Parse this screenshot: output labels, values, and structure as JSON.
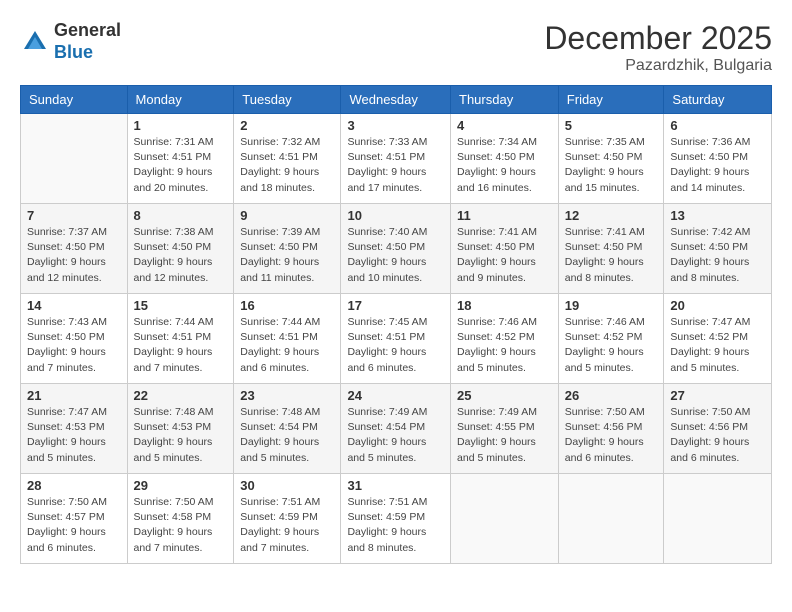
{
  "logo": {
    "general": "General",
    "blue": "Blue"
  },
  "title": {
    "month_year": "December 2025",
    "location": "Pazardzhik, Bulgaria"
  },
  "days_of_week": [
    "Sunday",
    "Monday",
    "Tuesday",
    "Wednesday",
    "Thursday",
    "Friday",
    "Saturday"
  ],
  "weeks": [
    [
      {
        "day": "",
        "info": ""
      },
      {
        "day": "1",
        "info": "Sunrise: 7:31 AM\nSunset: 4:51 PM\nDaylight: 9 hours\nand 20 minutes."
      },
      {
        "day": "2",
        "info": "Sunrise: 7:32 AM\nSunset: 4:51 PM\nDaylight: 9 hours\nand 18 minutes."
      },
      {
        "day": "3",
        "info": "Sunrise: 7:33 AM\nSunset: 4:51 PM\nDaylight: 9 hours\nand 17 minutes."
      },
      {
        "day": "4",
        "info": "Sunrise: 7:34 AM\nSunset: 4:50 PM\nDaylight: 9 hours\nand 16 minutes."
      },
      {
        "day": "5",
        "info": "Sunrise: 7:35 AM\nSunset: 4:50 PM\nDaylight: 9 hours\nand 15 minutes."
      },
      {
        "day": "6",
        "info": "Sunrise: 7:36 AM\nSunset: 4:50 PM\nDaylight: 9 hours\nand 14 minutes."
      }
    ],
    [
      {
        "day": "7",
        "info": "Sunrise: 7:37 AM\nSunset: 4:50 PM\nDaylight: 9 hours\nand 12 minutes."
      },
      {
        "day": "8",
        "info": "Sunrise: 7:38 AM\nSunset: 4:50 PM\nDaylight: 9 hours\nand 12 minutes."
      },
      {
        "day": "9",
        "info": "Sunrise: 7:39 AM\nSunset: 4:50 PM\nDaylight: 9 hours\nand 11 minutes."
      },
      {
        "day": "10",
        "info": "Sunrise: 7:40 AM\nSunset: 4:50 PM\nDaylight: 9 hours\nand 10 minutes."
      },
      {
        "day": "11",
        "info": "Sunrise: 7:41 AM\nSunset: 4:50 PM\nDaylight: 9 hours\nand 9 minutes."
      },
      {
        "day": "12",
        "info": "Sunrise: 7:41 AM\nSunset: 4:50 PM\nDaylight: 9 hours\nand 8 minutes."
      },
      {
        "day": "13",
        "info": "Sunrise: 7:42 AM\nSunset: 4:50 PM\nDaylight: 9 hours\nand 8 minutes."
      }
    ],
    [
      {
        "day": "14",
        "info": "Sunrise: 7:43 AM\nSunset: 4:50 PM\nDaylight: 9 hours\nand 7 minutes."
      },
      {
        "day": "15",
        "info": "Sunrise: 7:44 AM\nSunset: 4:51 PM\nDaylight: 9 hours\nand 7 minutes."
      },
      {
        "day": "16",
        "info": "Sunrise: 7:44 AM\nSunset: 4:51 PM\nDaylight: 9 hours\nand 6 minutes."
      },
      {
        "day": "17",
        "info": "Sunrise: 7:45 AM\nSunset: 4:51 PM\nDaylight: 9 hours\nand 6 minutes."
      },
      {
        "day": "18",
        "info": "Sunrise: 7:46 AM\nSunset: 4:52 PM\nDaylight: 9 hours\nand 5 minutes."
      },
      {
        "day": "19",
        "info": "Sunrise: 7:46 AM\nSunset: 4:52 PM\nDaylight: 9 hours\nand 5 minutes."
      },
      {
        "day": "20",
        "info": "Sunrise: 7:47 AM\nSunset: 4:52 PM\nDaylight: 9 hours\nand 5 minutes."
      }
    ],
    [
      {
        "day": "21",
        "info": "Sunrise: 7:47 AM\nSunset: 4:53 PM\nDaylight: 9 hours\nand 5 minutes."
      },
      {
        "day": "22",
        "info": "Sunrise: 7:48 AM\nSunset: 4:53 PM\nDaylight: 9 hours\nand 5 minutes."
      },
      {
        "day": "23",
        "info": "Sunrise: 7:48 AM\nSunset: 4:54 PM\nDaylight: 9 hours\nand 5 minutes."
      },
      {
        "day": "24",
        "info": "Sunrise: 7:49 AM\nSunset: 4:54 PM\nDaylight: 9 hours\nand 5 minutes."
      },
      {
        "day": "25",
        "info": "Sunrise: 7:49 AM\nSunset: 4:55 PM\nDaylight: 9 hours\nand 5 minutes."
      },
      {
        "day": "26",
        "info": "Sunrise: 7:50 AM\nSunset: 4:56 PM\nDaylight: 9 hours\nand 6 minutes."
      },
      {
        "day": "27",
        "info": "Sunrise: 7:50 AM\nSunset: 4:56 PM\nDaylight: 9 hours\nand 6 minutes."
      }
    ],
    [
      {
        "day": "28",
        "info": "Sunrise: 7:50 AM\nSunset: 4:57 PM\nDaylight: 9 hours\nand 6 minutes."
      },
      {
        "day": "29",
        "info": "Sunrise: 7:50 AM\nSunset: 4:58 PM\nDaylight: 9 hours\nand 7 minutes."
      },
      {
        "day": "30",
        "info": "Sunrise: 7:51 AM\nSunset: 4:59 PM\nDaylight: 9 hours\nand 7 minutes."
      },
      {
        "day": "31",
        "info": "Sunrise: 7:51 AM\nSunset: 4:59 PM\nDaylight: 9 hours\nand 8 minutes."
      },
      {
        "day": "",
        "info": ""
      },
      {
        "day": "",
        "info": ""
      },
      {
        "day": "",
        "info": ""
      }
    ]
  ]
}
